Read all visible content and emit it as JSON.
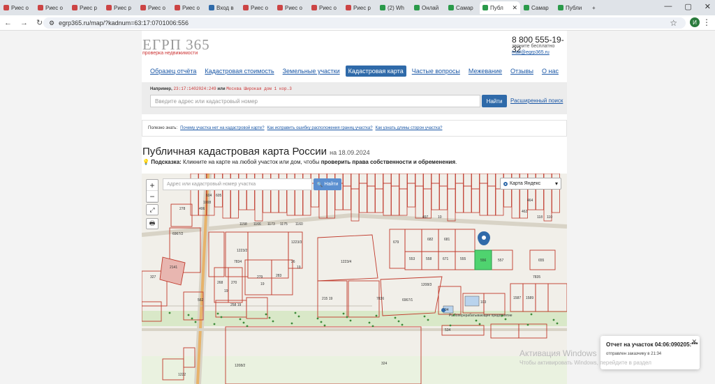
{
  "browser": {
    "tabs": [
      {
        "label": "Риес о"
      },
      {
        "label": "Риес о"
      },
      {
        "label": "Риес р"
      },
      {
        "label": "Риес р"
      },
      {
        "label": "Риес о"
      },
      {
        "label": "Риес о"
      },
      {
        "label": "Вход в"
      },
      {
        "label": "Риес о"
      },
      {
        "label": "Риес о"
      },
      {
        "label": "Риес о"
      },
      {
        "label": "Риес р"
      },
      {
        "label": "(2) Wh"
      },
      {
        "label": "Онлай"
      },
      {
        "label": "Самар"
      },
      {
        "label": "Публ"
      },
      {
        "label": "Самар"
      },
      {
        "label": "Публи"
      }
    ],
    "active_tab_close": "✕",
    "new_tab": "+",
    "url": "egrp365.ru/map/?kadnum=63:17:0701006:556",
    "avatar_letter": "И"
  },
  "header": {
    "logo": "ЕГРП 365",
    "logo_sub": "проверка недвижимости",
    "phone": "8 800 555-19-32",
    "phone_sub": "звоните бесплатно",
    "email": "mail@egrp365.ru"
  },
  "nav": [
    {
      "label": "Образец отчёта"
    },
    {
      "label": "Кадастровая стоимость"
    },
    {
      "label": "Земельные участки"
    },
    {
      "label": "Кадастровая карта"
    },
    {
      "label": "Частые вопросы"
    },
    {
      "label": "Межевание"
    },
    {
      "label": "Отзывы"
    },
    {
      "label": "О нас"
    }
  ],
  "search": {
    "example_prefix": "Например,",
    "example_kad": "23:17:1402024:249",
    "example_or": "или",
    "example_addr": "Москва Широкая дом 1 кор.3",
    "placeholder": "Введите адрес или кадастровый номер",
    "button": "Найти",
    "advanced": "Расширенный поиск"
  },
  "useful": {
    "label": "Полезно знать:",
    "links": [
      "Почему участка нет на кадастровой карте?",
      "Как исправить ошибку расположения границ участка?",
      "Как узнать длины сторон участка?"
    ]
  },
  "title": {
    "main": "Публичная кадастровая карта России",
    "date": "на 18.09.2024"
  },
  "hint": {
    "label": "Подсказка:",
    "text": "Кликните на карте на любой участок или дом, чтобы",
    "bold": "проверить права собственности и обременения",
    "end": "."
  },
  "map": {
    "search_placeholder": "Адрес или кадастровый номер участка",
    "search_button": "Найти",
    "type_label": "Карта Яндекс",
    "zoom_in": "+",
    "zoom_out": "−",
    "parcel_labels": [
      "278",
      "604",
      "605",
      "1008",
      "406",
      "1223/2",
      "7834",
      "1223/3",
      "1223/4",
      "26",
      "19",
      "553",
      "558",
      "671",
      "555",
      "556",
      "557",
      "655",
      "682",
      "681",
      "679",
      "7835",
      "1208/3",
      "6967/1",
      "215 19",
      "7836",
      "268",
      "19",
      "270",
      "279",
      "19",
      "283",
      "258 19",
      "327",
      "562",
      "1208/2",
      "324",
      "1222",
      "534",
      "103",
      "94",
      "1587",
      "1589",
      "6967/2",
      "2141",
      "1158",
      "1166",
      "1173",
      "1175",
      "1160",
      "497",
      "10",
      "118",
      "110",
      "462",
      "464"
    ],
    "place_label": "Рыбоперерабатывающее предприятие"
  },
  "notification": {
    "title": "Отчет на участок 04:06:090205:***",
    "subtitle": "отправлен заказчику в 21:34",
    "close": "✕"
  },
  "watermark": {
    "line1": "Активация Windows",
    "line2": "Чтобы активировать Windows, перейдите в раздел"
  }
}
